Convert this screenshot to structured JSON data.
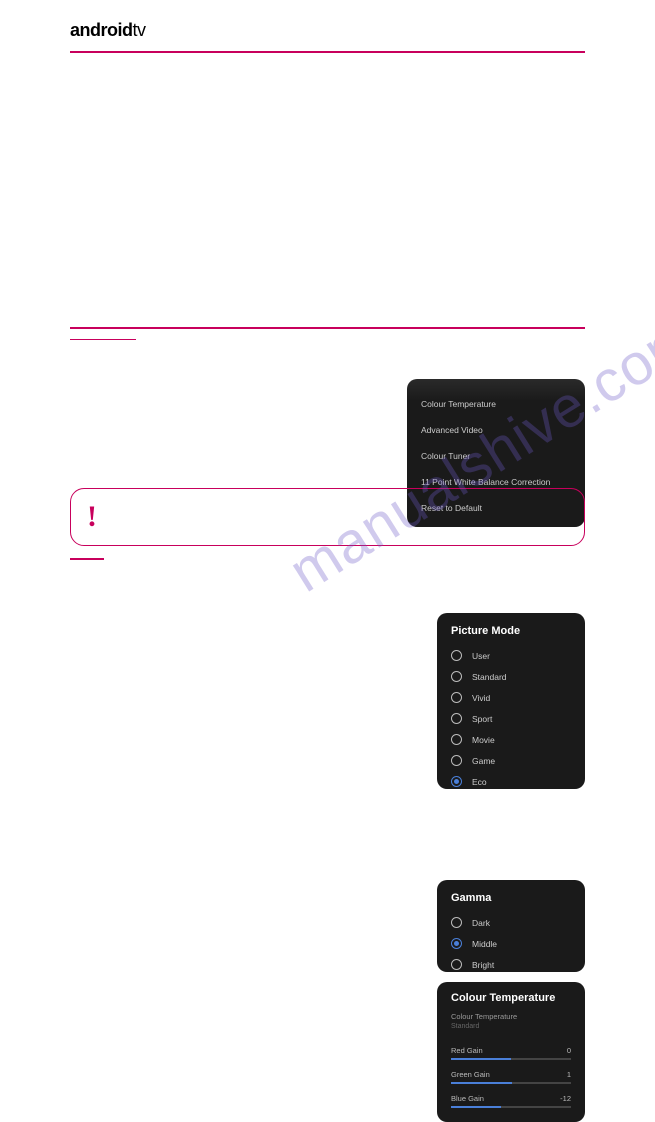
{
  "brand": {
    "bold": "android",
    "light": "tv"
  },
  "watermark": "manualshive.com",
  "panel_top": {
    "items": [
      "Colour Temperature",
      "Advanced Video",
      "Colour Tuner",
      "11 Point White Balance Correction",
      "Reset to Default"
    ]
  },
  "picture_mode": {
    "title": "Picture Mode",
    "options": [
      {
        "label": "User",
        "selected": false
      },
      {
        "label": "Standard",
        "selected": false
      },
      {
        "label": "Vivid",
        "selected": false
      },
      {
        "label": "Sport",
        "selected": false
      },
      {
        "label": "Movie",
        "selected": false
      },
      {
        "label": "Game",
        "selected": false
      },
      {
        "label": "Eco",
        "selected": true
      }
    ]
  },
  "callout": {
    "icon": "!"
  },
  "gamma": {
    "title": "Gamma",
    "options": [
      {
        "label": "Dark",
        "selected": false
      },
      {
        "label": "Middle",
        "selected": true
      },
      {
        "label": "Bright",
        "selected": false
      }
    ]
  },
  "colour_temp": {
    "title": "Colour Temperature",
    "sub_label": "Colour Temperature",
    "sub_value": "Standard",
    "sliders": [
      {
        "label": "Red Gain",
        "value": "0",
        "fill": 50
      },
      {
        "label": "Green Gain",
        "value": "1",
        "fill": 51
      },
      {
        "label": "Blue Gain",
        "value": "-12",
        "fill": 42
      }
    ]
  },
  "page_number": ""
}
